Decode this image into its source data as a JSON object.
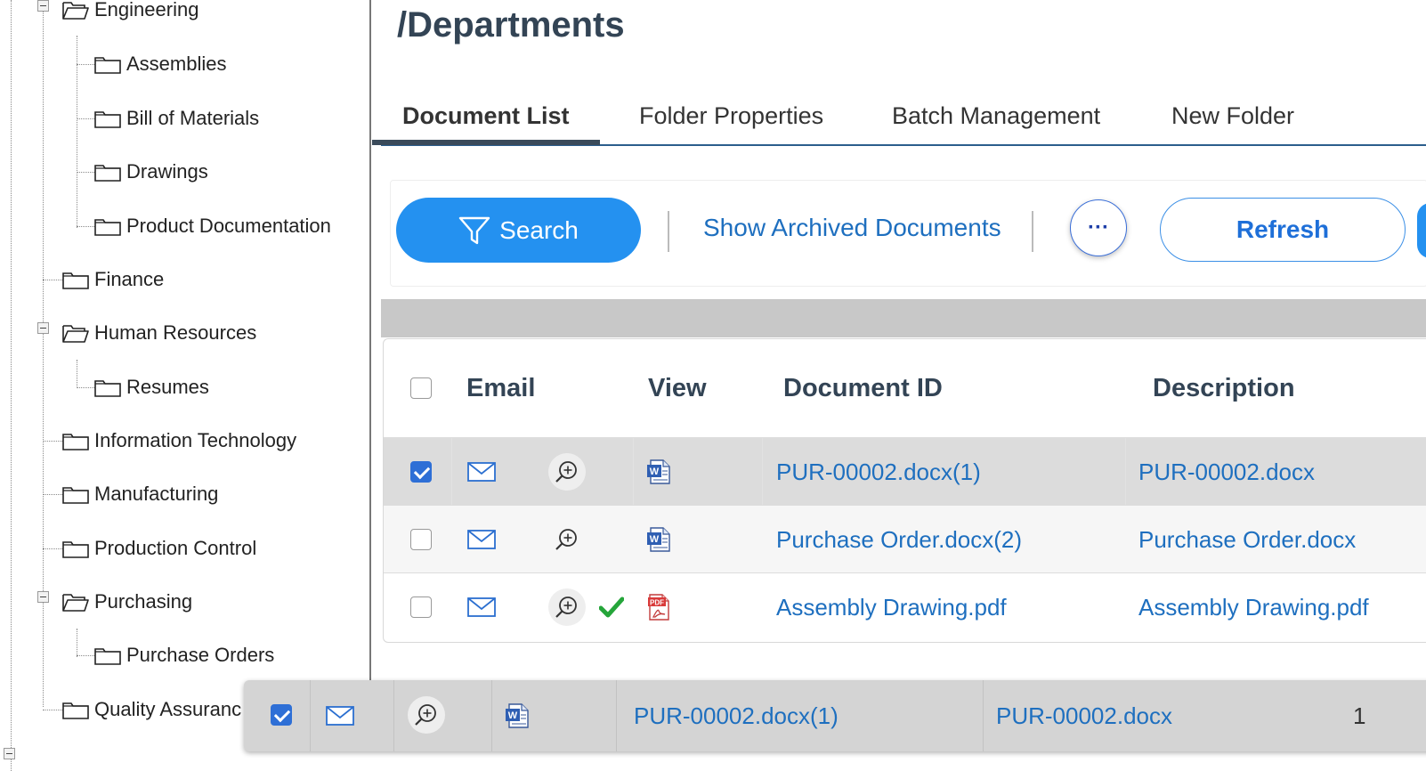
{
  "tree": {
    "items": [
      {
        "label": "Engineering",
        "state": "open"
      },
      {
        "label": "Assemblies",
        "state": "closed"
      },
      {
        "label": "Bill of Materials",
        "state": "closed"
      },
      {
        "label": "Drawings",
        "state": "closed"
      },
      {
        "label": "Product Documentation",
        "state": "closed"
      },
      {
        "label": "Finance",
        "state": "closed"
      },
      {
        "label": "Human Resources",
        "state": "open"
      },
      {
        "label": "Resumes",
        "state": "closed"
      },
      {
        "label": "Information Technology",
        "state": "closed"
      },
      {
        "label": "Manufacturing",
        "state": "closed"
      },
      {
        "label": "Production Control",
        "state": "closed"
      },
      {
        "label": "Purchasing",
        "state": "open"
      },
      {
        "label": "Purchase Orders",
        "state": "selected"
      },
      {
        "label": "Quality Assuranc",
        "state": "closed"
      }
    ]
  },
  "page": {
    "title": "/Departments"
  },
  "tabs": [
    {
      "label": "Document List",
      "active": true
    },
    {
      "label": "Folder Properties",
      "active": false
    },
    {
      "label": "Batch Management",
      "active": false
    },
    {
      "label": "New Folder",
      "active": false
    }
  ],
  "toolbar": {
    "search_label": "Search",
    "archived_label": "Show Archived Documents",
    "more_label": "···",
    "refresh_label": "Refresh"
  },
  "grid": {
    "headers": {
      "email": "Email",
      "view": "View",
      "doc_id": "Document ID",
      "description": "Description"
    },
    "rows": [
      {
        "checked": true,
        "file_type": "word",
        "approved": false,
        "doc_id": "PUR-00002.docx(1)",
        "description": "PUR-00002.docx"
      },
      {
        "checked": false,
        "file_type": "word",
        "approved": false,
        "doc_id": "Purchase Order.docx(2)",
        "description": "Purchase Order.docx"
      },
      {
        "checked": false,
        "file_type": "pdf",
        "approved": true,
        "doc_id": "Assembly Drawing.pdf",
        "description": "Assembly Drawing.pdf"
      }
    ]
  },
  "drag_ghost": {
    "checked": true,
    "doc_id": "PUR-00002.docx(1)",
    "description": "PUR-00002.docx",
    "count": "1"
  },
  "colors": {
    "accent": "#2491f0",
    "link": "#1e6fbf",
    "selected_row": "#dcdcdc"
  }
}
